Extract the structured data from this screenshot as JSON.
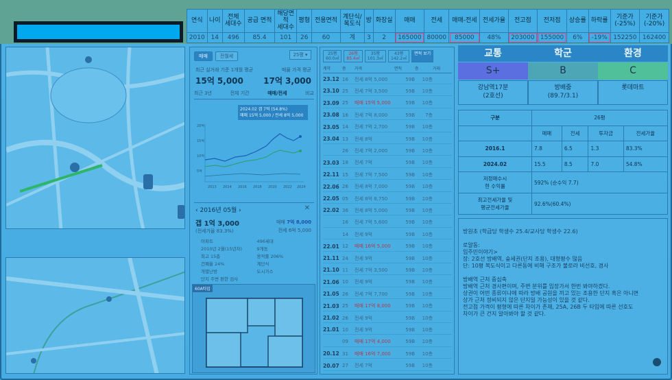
{
  "summary": {
    "headers": [
      "연식",
      "나이",
      "전체\n세대수",
      "공급 면적",
      "해당면\n적\n세대수",
      "평형",
      "전용면적",
      "계단식/\n복도식",
      "방",
      "화장실",
      "매매",
      "전세",
      "매매-전세",
      "전세가율",
      "전고점",
      "전저점",
      "상승률",
      "하락률",
      "기준가\n(-25%)",
      "기준가\n(-20%)"
    ],
    "values": [
      "2010",
      "14",
      "496",
      "85.4",
      "101",
      "26",
      "60",
      "계",
      "3",
      "2",
      "165000",
      "80000",
      "85000",
      "48%",
      "203000",
      "155000",
      "6%",
      "-19%",
      "152250",
      "162400"
    ]
  },
  "price": {
    "tabs": [
      "매매",
      "전월세"
    ],
    "select": "25평",
    "recent_label": "최근 실거래 기준 1개월 평균",
    "recent_value": "15억 5,000",
    "ask_label": "매물 가격 평균",
    "ask_value": "17억 3,000",
    "subtabs": [
      "최근 3년",
      "전체 기간",
      "매매/전세",
      "비교"
    ],
    "tooltip_date": "2024.02  갭 7억 (54.8%)",
    "tooltip_line": "매매 15억 5,000 / 전세 8억 5,000",
    "year_ticks": [
      "2013",
      "2014",
      "2016",
      "2018",
      "2020",
      "2022",
      "2024"
    ],
    "y_ticks": [
      "20억",
      "15억",
      "10억",
      "5억"
    ],
    "gap_title": "2016년 05월",
    "gap_value": "갭 1억 3,000",
    "gap_sub": "(전세가율 83.3%)",
    "gap_sale_label": "매매",
    "gap_sale_value": "7억 8,000",
    "gap_lease_label": "전세",
    "gap_lease_value": "6억 5,000",
    "features": [
      "아파트",
      "496세대",
      "2010년 2월(15년차)",
      "9개동",
      "최고 15층",
      "용적률 206%",
      "건폐율 24%",
      "계단식",
      "개별난방",
      "도시가스",
      "단지 주변 편한 검사"
    ],
    "plan_label": "60A타입"
  },
  "tx": {
    "tabs": [
      "25평\n60.0㎡",
      "26평\n85.4㎡",
      "35평\n101.3㎡",
      "43평\n142.2㎡",
      "면적 보기"
    ],
    "header": [
      "계약",
      "층",
      "가격",
      "면적",
      "층",
      "거래"
    ],
    "rows": [
      {
        "d": "23.12",
        "f": "16",
        "k": "전세 8억 5,000",
        "a": "59B",
        "fl": "10층"
      },
      {
        "d": "23.10",
        "f": "25",
        "k": "전세 7억 3,500",
        "a": "59B",
        "fl": "10층"
      },
      {
        "d": "23.09",
        "f": "25",
        "k": "매매 15억 5,000",
        "a": "59B",
        "fl": "10층",
        "sale": true
      },
      {
        "d": "23.08",
        "f": "16",
        "k": "전세 7억 8,000",
        "a": "59B",
        "fl": "7층"
      },
      {
        "d": "23.05",
        "f": "14",
        "k": "전세 7억 2,700",
        "a": "59B",
        "fl": "10층"
      },
      {
        "d": "23.04",
        "f": "13",
        "k": "전세 8억",
        "a": "59B",
        "fl": "10층"
      },
      {
        "d": "",
        "f": "26",
        "k": "전세 7억 2,000",
        "a": "59B",
        "fl": "10층"
      },
      {
        "d": "23.03",
        "f": "18",
        "k": "전세 7억",
        "a": "59B",
        "fl": "10층"
      },
      {
        "d": "22.11",
        "f": "15",
        "k": "전세 7억 7,500",
        "a": "59B",
        "fl": "10층"
      },
      {
        "d": "22.06",
        "f": "26",
        "k": "전세 8억 7,000",
        "a": "59B",
        "fl": "10층"
      },
      {
        "d": "22.05",
        "f": "05",
        "k": "전세 8억 8,750",
        "a": "59B",
        "fl": "10층"
      },
      {
        "d": "22.02",
        "f": "36",
        "k": "전세 8억 5,000",
        "a": "59B",
        "fl": "10층"
      },
      {
        "d": "",
        "f": "16",
        "k": "전세 7억 5,600",
        "a": "59B",
        "fl": "10층"
      },
      {
        "d": "",
        "f": "14",
        "k": "전세 9억",
        "a": "59B",
        "fl": "10층"
      },
      {
        "d": "22.01",
        "f": "12",
        "k": "매매 16억 5,000",
        "a": "59B",
        "fl": "10층",
        "sale": true
      },
      {
        "d": "21.11",
        "f": "24",
        "k": "전세 9억",
        "a": "59B",
        "fl": "10층"
      },
      {
        "d": "21.10",
        "f": "11",
        "k": "전세 7억 3,500",
        "a": "59B",
        "fl": "10층"
      },
      {
        "d": "21.06",
        "f": "10",
        "k": "전세 9억",
        "a": "59B",
        "fl": "10층"
      },
      {
        "d": "21.05",
        "f": "26",
        "k": "전세 7억 7,700",
        "a": "59B",
        "fl": "10층"
      },
      {
        "d": "21.03",
        "f": "25",
        "k": "매매 17억 8,000",
        "a": "59B",
        "fl": "10층",
        "sale": true
      },
      {
        "d": "21.02",
        "f": "26",
        "k": "전세 9억",
        "a": "59B",
        "fl": "10층"
      },
      {
        "d": "21.01",
        "f": "10",
        "k": "전세 9억",
        "a": "59B",
        "fl": "10층"
      },
      {
        "d": "",
        "f": "09",
        "k": "매매 17억 4,000",
        "a": "59B",
        "fl": "10층",
        "sale": true
      },
      {
        "d": "20.12",
        "f": "31",
        "k": "매매 16억 7,000",
        "a": "59B",
        "fl": "10층",
        "sale": true
      },
      {
        "d": "20.07",
        "f": "27",
        "k": "전세 7억",
        "a": "59B",
        "fl": "10층"
      }
    ]
  },
  "score": {
    "heads": [
      "교통",
      "학군",
      "환경"
    ],
    "grades": [
      "S+",
      "B",
      "C"
    ],
    "grade_colors": [
      "#5b6fe0",
      "#4da6b6",
      "#4fc09a"
    ],
    "descs": [
      "강남역17분\n(2호선)",
      "방배중\n(89.7/3.1)",
      "롯데마트"
    ]
  },
  "calc": {
    "type_label": "구분",
    "size_label": "26평",
    "cols": [
      "매매",
      "전세",
      "투자금",
      "전세가율"
    ],
    "rows": [
      {
        "label": "2016.1",
        "vals": [
          "7.8",
          "6.5",
          "1.3",
          "83.3%"
        ]
      },
      {
        "label": "2024.02",
        "vals": [
          "15.5",
          "8.5",
          "7.0",
          "54.8%"
        ]
      }
    ],
    "expect_label": "저정매수시\n현 수익률",
    "expect_value": "592% (순수익 7.7)",
    "max_label": "최고전세가율 및\n평균전세가율",
    "max_value": "92.6%(60.4%)"
  },
  "memo": {
    "lines": [
      "방원초 (학급당 학생수 25.4/교사당 학생수 22.6)",
      "",
      "로얄동:",
      "임주민이야기>",
      "장: 2호선 방배역, 숲세권(단지 조용), 대형평수 많음",
      "단: 10평 복도식이고 다른동에 비해 구조가 불로라 비선호, 경사",
      "",
      "방배역 근처 중심축",
      "방배역 근처 경사편이며, 주변 분위를 임장가서 한번 봐야하겠다.",
      "상권이 어떤 종류이냐에 따라 방배 공원을 끼고 있는 조용한 단지 혹은 아니면",
      "상가 근처 정비되지 않은 단지일 가능성이 있을 것 같다.",
      "전고점 가격이 평형에 따른 차이가 존재, 25A, 26B 두 타입에 따른 선호도",
      "차이가 큰 건지 알아봐야 할 것 같다."
    ]
  }
}
